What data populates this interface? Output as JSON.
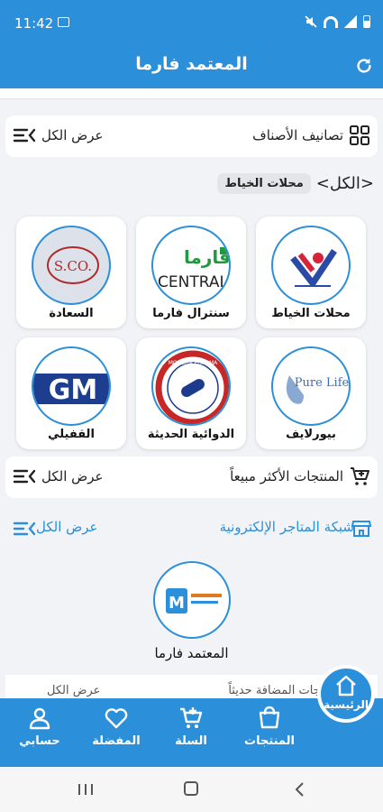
{
  "status": {
    "time": "11:42"
  },
  "app": {
    "title": "المعتمد فارما"
  },
  "categories_section": {
    "title": "تصانيف الأصناف",
    "view_all": "عرض الكل"
  },
  "breadcrumb": {
    "root": "<الكل>",
    "current": "محلات الخياط"
  },
  "stores": [
    {
      "name": "محلات الخياط"
    },
    {
      "name": "سنترال فارما",
      "logo_text_top": "فارما",
      "logo_text_bottom": "CENTRAL"
    },
    {
      "name": "السعادة",
      "logo_text": "S.CO."
    },
    {
      "name": "بيورلايف",
      "logo_text": "Pure Life"
    },
    {
      "name": "الدوائية الحديثة",
      "logo_text": "MODERN PHARMA"
    },
    {
      "name": "القفيلي",
      "logo_text": "GM"
    }
  ],
  "bestsellers_section": {
    "title": "المنتجات الأكثر مبيعاً",
    "view_all": "عرض الكل"
  },
  "network_section": {
    "title": "شبكة المتاجر الإلكترونية",
    "view_all": "عرض الكل"
  },
  "featured_store": {
    "name": "المعتمد فارما"
  },
  "peek_row": {
    "title": "المنتجات المضافة حديثاً",
    "view_all": "عرض الكل"
  },
  "bottom_nav": {
    "home": "الرئيسية",
    "products": "المنتجات",
    "cart": "السلة",
    "favorites": "المفضلة",
    "account": "حسابي"
  },
  "colors": {
    "primary": "#2b8fd9",
    "background": "#f1f3f6"
  }
}
